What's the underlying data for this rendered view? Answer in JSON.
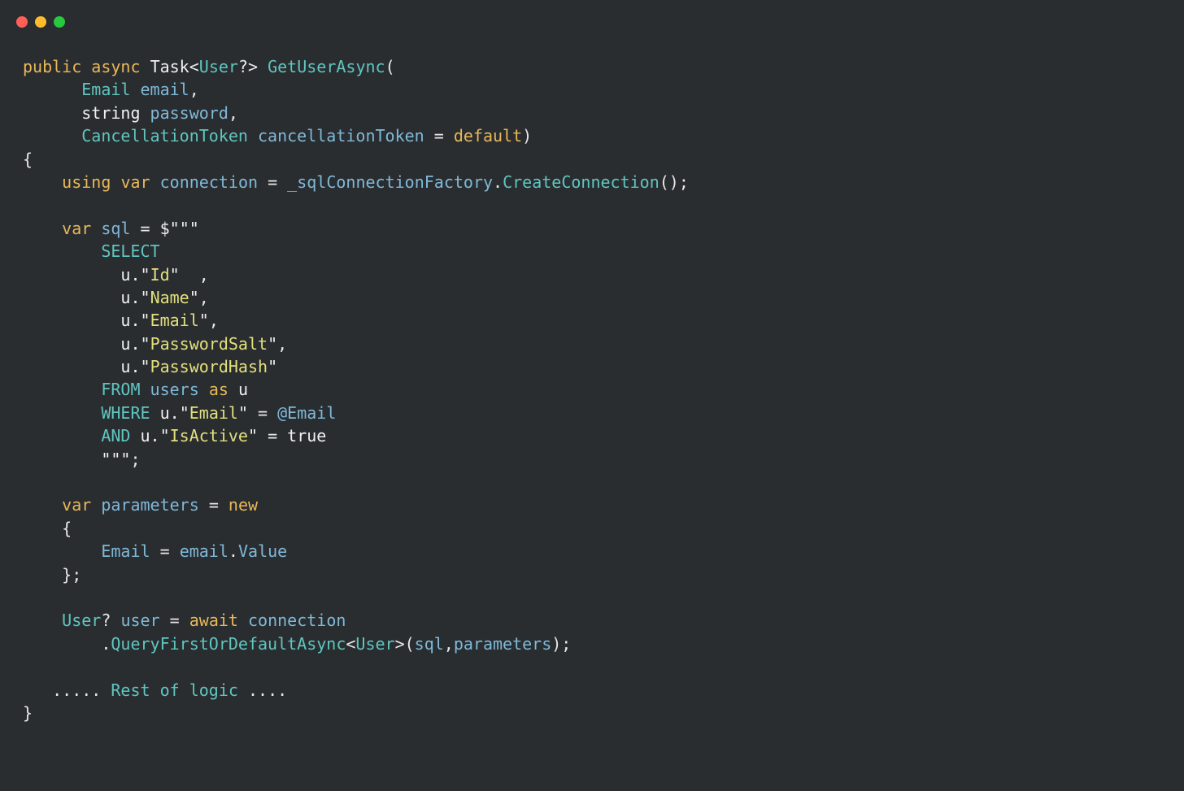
{
  "window": {
    "traffic_lights": [
      "close",
      "minimize",
      "maximize"
    ]
  },
  "code": {
    "line1": {
      "k1": "public",
      "k2": "async",
      "t1": "Task",
      "t2": "User",
      "q": "?",
      "m": "GetUserAsync",
      "p": "("
    },
    "line2": {
      "t": "Email",
      "n": "email",
      "c": ","
    },
    "line3": {
      "t": "string",
      "n": "password",
      "c": ","
    },
    "line4": {
      "t": "CancellationToken",
      "n": "cancellationToken",
      "eq": "=",
      "d": "default",
      "p": ")"
    },
    "line5": {
      "b": "{"
    },
    "line6": {
      "k1": "using",
      "k2": "var",
      "n": "connection",
      "eq": "=",
      "f": "_sqlConnectionFactory",
      "dot": ".",
      "m": "CreateConnection",
      "p": "();"
    },
    "line7": "",
    "line8": {
      "k": "var",
      "n": "sql",
      "eq": "=",
      "d": "$",
      "q": "\"\"\""
    },
    "line9": {
      "s": "SELECT"
    },
    "line10": {
      "u": "u.",
      "q1": "\"",
      "c": "Id",
      "q2": "\"",
      "sp": "  ,",
      "comma": ""
    },
    "line11": {
      "u": "u.",
      "q1": "\"",
      "c": "Name",
      "q2": "\"",
      "comma": ","
    },
    "line12": {
      "u": "u.",
      "q1": "\"",
      "c": "Email",
      "q2": "\"",
      "comma": ","
    },
    "line13": {
      "u": "u.",
      "q1": "\"",
      "c": "PasswordSalt",
      "q2": "\"",
      "comma": ","
    },
    "line14": {
      "u": "u.",
      "q1": "\"",
      "c": "PasswordHash",
      "q2": "\""
    },
    "line15": {
      "s1": "FROM",
      "t": "users",
      "s2": "as",
      "a": "u"
    },
    "line16": {
      "s": "WHERE",
      "u": "u.",
      "q1": "\"",
      "c": "Email",
      "q2": "\"",
      "eq": "=",
      "p": "@Email"
    },
    "line17": {
      "s": "AND",
      "u": "u.",
      "q1": "\"",
      "c": "IsActive",
      "q2": "\"",
      "eq": "=",
      "v": "true"
    },
    "line18": {
      "q": "\"\"\"",
      "sc": ";"
    },
    "line19": "",
    "line20": {
      "k": "var",
      "n": "parameters",
      "eq": "=",
      "nw": "new"
    },
    "line21": {
      "b": "{"
    },
    "line22": {
      "p": "Email",
      "eq": "=",
      "o": "email",
      "dot": ".",
      "prop": "Value"
    },
    "line23": {
      "b": "};"
    },
    "line24": "",
    "line25": {
      "t": "User",
      "q": "?",
      "n": "user",
      "eq": "=",
      "aw": "await",
      "c": "connection"
    },
    "line26": {
      "dot": ".",
      "m": "QueryFirstOrDefaultAsync",
      "lt": "<",
      "t": "User",
      "gt": ">",
      "p1": "(",
      "a1": "sql",
      "comma": ",",
      "a2": "parameters",
      "p2": ");"
    },
    "line27": "",
    "line28": {
      "d1": ".....",
      "t": "Rest of logic",
      "d2": "...."
    },
    "line29": {
      "b": "}"
    }
  }
}
